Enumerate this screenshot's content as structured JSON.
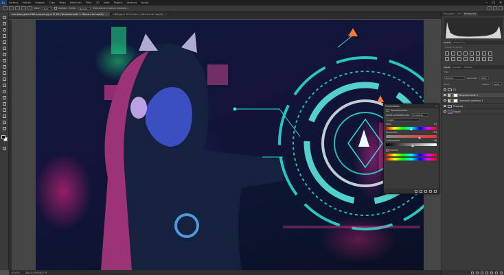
{
  "menu": {
    "items": [
      "Archivo",
      "Edición",
      "Imagen",
      "Capa",
      "Texto",
      "Selección",
      "Filtro",
      "3D",
      "Vista",
      "Plugins",
      "Ventana",
      "Ayuda"
    ]
  },
  "options": {
    "label_feather": "Calar:",
    "feather_value": "0 px",
    "label_antialias": "Suavizar",
    "label_style": "Estilo:",
    "style_value": "Normal",
    "label_mask": "Seleccionar y aplicar máscara..."
  },
  "tabs": [
    {
      "label": "mas-fotos-gratis-HDR-emplazh.jpg al 91,6% (Tono/saturación 1, Máscara de capa/8)",
      "active": true
    },
    {
      "label": "HDR.jpg al 50% (Capa 1, Máscara de capa/8)",
      "active": false
    }
  ],
  "status": {
    "zoom": "91,67%",
    "doc": "Doc: 6,93 M/40,7 M"
  },
  "dock": {
    "top_tabs": [
      "Navegador",
      "Info",
      "Histograma"
    ],
    "mid_tabs": [
      "Ajustes",
      "Bibliotecas"
    ],
    "adj_hint": "Añadir un ajuste",
    "layer_tabs": [
      "Capas",
      "Canales",
      "Trazados"
    ],
    "kind_label": "Tipo",
    "blend_mode": "Normal",
    "opacity_label": "Opacidad:",
    "opacity_value": "100%",
    "fill_label": "Relleno:",
    "fill_value": "100%",
    "lock_label": "Bloq.:",
    "layers": [
      {
        "name": "FX",
        "type": "folder",
        "selected": false
      },
      {
        "name": "Tono/saturación 1",
        "type": "adjustment",
        "selected": true
      },
      {
        "name": "Corrección selectiva 1",
        "type": "adjustment",
        "selected": false
      },
      {
        "name": "Personas",
        "type": "folder",
        "selected": false
      },
      {
        "name": "Capa 0",
        "type": "photo",
        "selected": false
      }
    ]
  },
  "properties": {
    "tabs": [
      "Propiedades"
    ],
    "title": "Tono/saturación",
    "preset_label": "Ajuste preestablecido:",
    "preset_value": "A medida",
    "channel_value": "Cuatro",
    "hue_label": "Tono:",
    "hue_value": "+1",
    "hue_fraction": 0.505,
    "sat_label": "Saturación:",
    "sat_value": "+33",
    "sat_fraction": 0.665,
    "lum_label": "Luminosidad:",
    "lum_value": "+6",
    "lum_fraction": 0.53,
    "colorize_label": "Colorear"
  }
}
